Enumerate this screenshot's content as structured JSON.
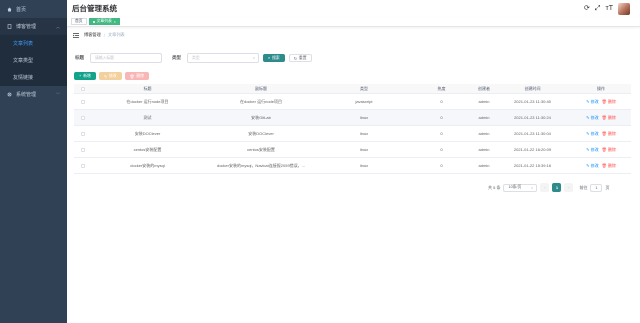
{
  "sidebar": {
    "home": "首页",
    "group": "博客管理",
    "sub_items": [
      "文章列表",
      "文章类型",
      "友情链接"
    ],
    "system": "系统管理"
  },
  "header": {
    "title": "后台管理系统"
  },
  "tags": {
    "home": "首页",
    "active": "文章列表"
  },
  "breadcrumb": {
    "first": "博客管理",
    "current": "文章列表"
  },
  "search": {
    "title_label": "标题",
    "title_placeholder": "请输入标题",
    "type_label": "类型",
    "type_placeholder": "类型",
    "search_button": "搜索",
    "reset_button": "重置"
  },
  "toolbar": {
    "add": "新增",
    "edit": "修改",
    "delete": "删除"
  },
  "table": {
    "headers": [
      "标题",
      "副标题",
      "类型",
      "热度",
      "创建者",
      "创建时间",
      "操作"
    ],
    "rows": [
      {
        "title": "在docker 运行node项目",
        "subtitle": "在docker 运行node项目",
        "type": "javascript",
        "views": "0",
        "creator": "admin",
        "time": "2021-01-23 11:30:45"
      },
      {
        "title": "测试",
        "subtitle": "安装GitLab",
        "type": "linux",
        "views": "0",
        "creator": "admin",
        "time": "2021-01-23 11:30:24"
      },
      {
        "title": "安装DOClever",
        "subtitle": "安装DOClever",
        "type": "linux",
        "views": "0",
        "creator": "admin",
        "time": "2021-01-23 11:30:04"
      },
      {
        "title": "centos安装配置",
        "subtitle": "centos安装配置",
        "type": "linux",
        "views": "0",
        "creator": "admin",
        "time": "2021-01-22 16:20:09"
      },
      {
        "title": "docker安装的mysql",
        "subtitle": "docker安装的mysql，Navicat连接报2059错误，...",
        "type": "linux",
        "views": "0",
        "creator": "admin",
        "time": "2021-01-22 15:39:16"
      }
    ],
    "op_edit": "修改",
    "op_delete": "删除"
  },
  "pagination": {
    "total": "共 5 条",
    "page_size": "10条/页",
    "current_page": "1",
    "goto_label": "前往",
    "goto_value": "1",
    "page_suffix": "页"
  },
  "colors": {
    "sidebar_bg": "#304156",
    "primary": "#2e8b8b",
    "tag_active": "#42b983"
  }
}
